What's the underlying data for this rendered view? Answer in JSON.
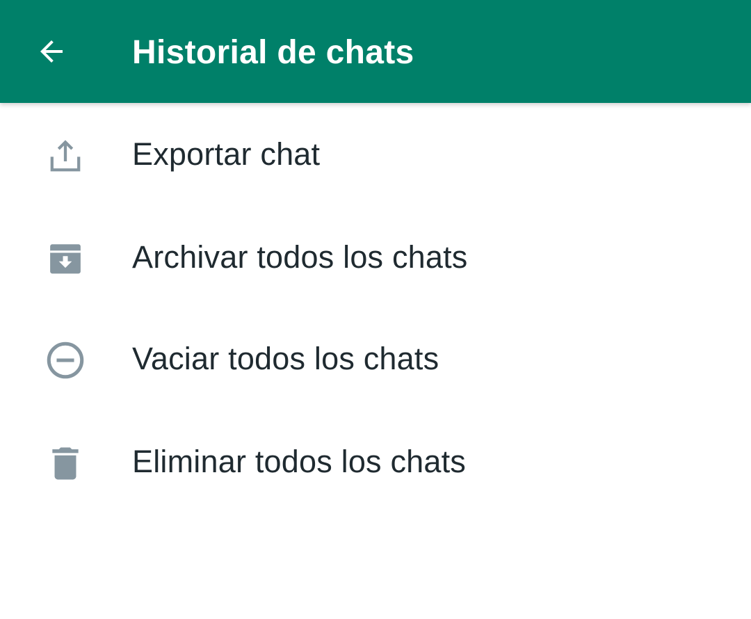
{
  "colors": {
    "app_bar": "#008069",
    "app_bar_text": "#ffffff",
    "icon": "#8696a0",
    "label_text": "#1f2a30",
    "background": "#ffffff"
  },
  "header": {
    "back_icon": "arrow-left-icon",
    "title": "Historial de chats"
  },
  "menu": {
    "items": [
      {
        "label": "Exportar chat",
        "icon": "share-upload-icon"
      },
      {
        "label": "Archivar todos los chats",
        "icon": "archive-box-icon"
      },
      {
        "label": "Vaciar todos los chats",
        "icon": "minus-circle-icon"
      },
      {
        "label": "Eliminar todos los chats",
        "icon": "trash-icon"
      }
    ]
  }
}
